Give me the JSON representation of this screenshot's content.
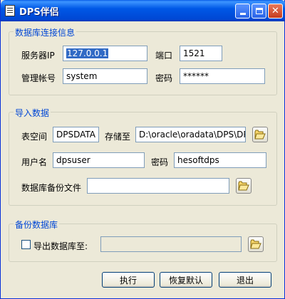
{
  "window": {
    "title": "DPS伴侣"
  },
  "db_connection": {
    "title": "数据库连接信息",
    "server_ip_label": "服务器IP",
    "server_ip_value": "127.0.0.1",
    "port_label": "端口",
    "port_value": "1521",
    "account_label": "管理帐号",
    "account_value": "system",
    "password_label": "密码",
    "password_value": "******"
  },
  "import": {
    "title": "导入数据",
    "tablespace_label": "表空间",
    "tablespace_value": "DPSDATA",
    "store_to_label": "存储至",
    "store_to_value": "D:\\oracle\\oradata\\DPS\\DPS",
    "username_label": "用户名",
    "username_value": "dpsuser",
    "password_label": "密码",
    "password_value": "hesoftdps",
    "backup_file_label": "数据库备份文件",
    "backup_file_value": ""
  },
  "backup": {
    "title": "备份数据库",
    "export_label": "导出数据库至:",
    "export_checked": false,
    "export_value": ""
  },
  "buttons": {
    "execute": "执行",
    "restore_default": "恢复默认",
    "exit": "退出"
  },
  "icons": {
    "app": "notepad-icon",
    "browse": "folder-open-icon"
  },
  "colors": {
    "titlebar": "#0058e6",
    "group_title": "#0046d5",
    "window_bg": "#ece9d8"
  }
}
